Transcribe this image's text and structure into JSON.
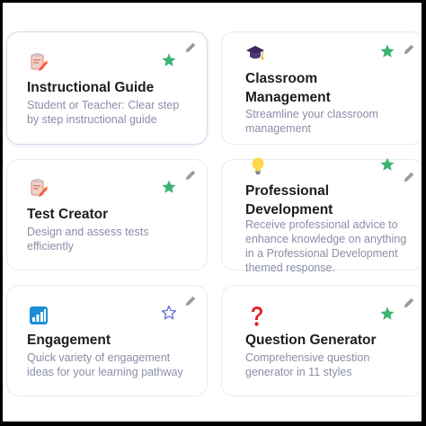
{
  "cards": [
    {
      "title": "Instructional Guide",
      "description": "Student or Teacher: Clear step by step instructional guide",
      "icon": "clipboard-pencil-icon",
      "favorited": true
    },
    {
      "title": "Classroom Management",
      "description": "Streamline your classroom management",
      "icon": "graduation-cap-icon",
      "favorited": true
    },
    {
      "title": "Test Creator",
      "description": "Design and assess tests efficiently",
      "icon": "clipboard-pencil-icon",
      "favorited": true
    },
    {
      "title": "Professional Development",
      "description": "Receive professional advice to enhance  knowledge on anything in a Professional Development themed response.",
      "icon": "light-bulb-icon",
      "favorited": true
    },
    {
      "title": "Engagement",
      "description": "Quick variety of engagement ideas for your learning pathway",
      "icon": "bar-chart-icon",
      "favorited": false
    },
    {
      "title": "Question Generator",
      "description": "Comprehensive question generator in 11 styles",
      "icon": "question-mark-icon",
      "favorited": true
    }
  ],
  "colors": {
    "star_filled": "#3cb371",
    "star_outline": "#5563d6",
    "pencil": "#9a9a9a",
    "title": "#1d1d1f",
    "description": "#8a8ea8"
  }
}
